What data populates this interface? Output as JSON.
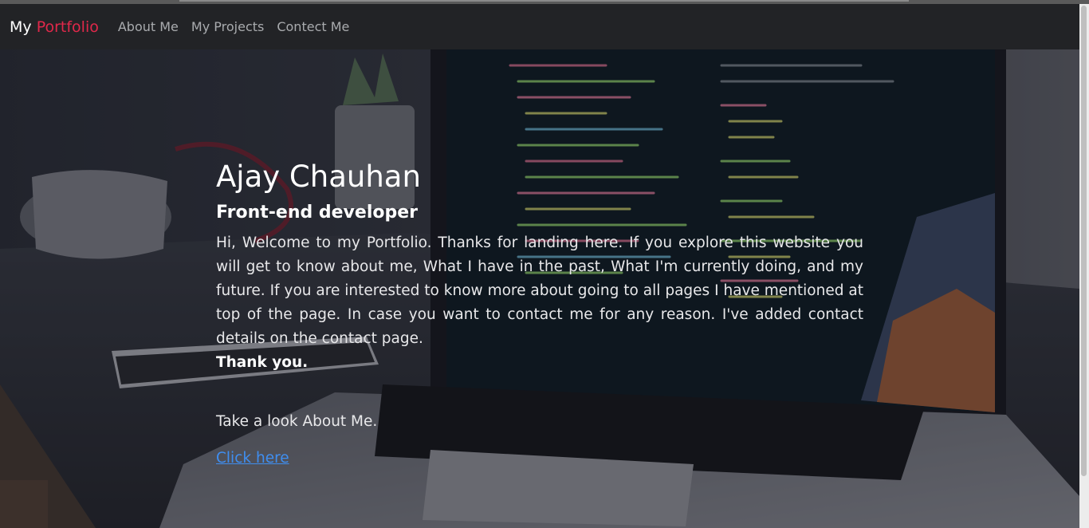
{
  "navbar": {
    "brand_prefix": "My",
    "brand_accent": "Portfolio",
    "links": [
      "About Me",
      "My Projects",
      "Contect Me"
    ]
  },
  "hero": {
    "name": "Ajay Chauhan",
    "role": "Front-end developer",
    "intro": "Hi, Welcome to my Portfolio. Thanks for landing here. If you explore this website you will get to know about me, What I have in the past, What I'm currently doing, and my future. If you are interested to know more about going to all pages I have mentioned at top of the page. In case you want to contact me for any reason. I've added contact details on the contact page.",
    "thanks": "Thank you.",
    "cta_text": "Take a look About Me.",
    "cta_link": "Click here"
  },
  "colors": {
    "accent": "#e0284a",
    "navbar_bg": "#222326",
    "link": "#3f8ef0"
  }
}
